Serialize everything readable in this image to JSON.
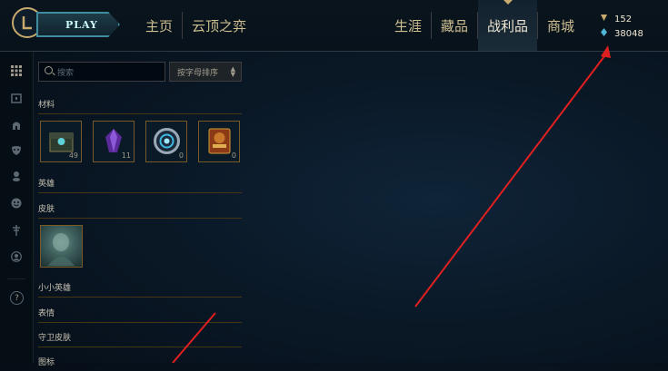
{
  "header": {
    "play_label": "PLAY",
    "nav_left": [
      "主页",
      "云顶之弈"
    ],
    "nav_right": [
      "生涯",
      "藏品",
      "战利品",
      "商城"
    ],
    "active_tab": "战利品"
  },
  "currency": {
    "rp": "152",
    "be": "38048"
  },
  "search": {
    "placeholder": "搜索"
  },
  "sort": {
    "label": "按字母排序"
  },
  "sections": {
    "materials": "材料",
    "champions": "英雄",
    "skins": "皮肤",
    "little_legends": "小小英雄",
    "emotes": "表情",
    "ward_skins": "守卫皮肤",
    "icons": "图标"
  },
  "materials": [
    {
      "icon": "hextech-chest-icon",
      "count": "49"
    },
    {
      "icon": "mythic-essence-crystal-icon",
      "count": "11"
    },
    {
      "icon": "hextech-key-icon",
      "count": "0"
    },
    {
      "icon": "2020-event-chest-icon",
      "count": "0"
    }
  ],
  "colors": {
    "gold": "#c8aa6e",
    "annotation_arrow": "#e02020"
  }
}
